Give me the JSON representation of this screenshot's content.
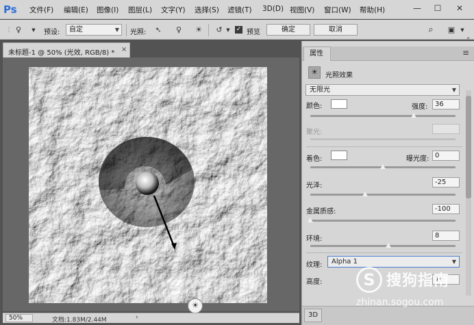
{
  "app": {
    "logo": "Ps"
  },
  "menu": [
    "文件(F)",
    "编辑(E)",
    "图像(I)",
    "图层(L)",
    "文字(Y)",
    "选择(S)",
    "滤镜(T)",
    "3D(D)",
    "视图(V)",
    "窗口(W)",
    "帮助(H)"
  ],
  "window_controls": {
    "minimize": "—",
    "restore": "☐",
    "close": "✕"
  },
  "options": {
    "preset_label": "预设:",
    "preset_value": "自定",
    "light_label": "光照:",
    "preview_label": "预览",
    "preview_checked": true,
    "ok_label": "确定",
    "cancel_label": "取消"
  },
  "document": {
    "tab_title": "未标题-1 @ 50% (光效, RGB/8) *",
    "close": "×",
    "zoom": "50%",
    "doc_size": "文档:1.83M/2.44M",
    "status_arrow": "›"
  },
  "panel": {
    "tab_label": "属性",
    "menu_icon": "≡",
    "collapse_icon": "»",
    "header_title": "光照效果",
    "light_type": "无限光",
    "rows": {
      "color_label": "颜色:",
      "intensity_label": "强度:",
      "intensity_value": "36",
      "intensity_level": 0.71,
      "hotspot_label": "聚光:",
      "colorize_label": "着色:",
      "exposure_label": "曝光度:",
      "exposure_value": "0",
      "exposure_level": 0.5,
      "gloss_label": "光泽:",
      "gloss_value": "-25",
      "gloss_level": 0.375,
      "metallic_label": "金属质感:",
      "metallic_value": "-100",
      "metallic_level": 0.0,
      "ambience_label": "环境:",
      "ambience_value": "8",
      "ambience_level": 0.54,
      "texture_label": "纹理:",
      "texture_value": "Alpha 1",
      "height_label": "高度:",
      "height_value": "10"
    },
    "bottom_button": "3D"
  },
  "watermark": {
    "logo_char": "S",
    "name": "搜狗指南",
    "url": "zhinan.sogou.com"
  },
  "colors": {
    "ps_blue": "#2d6fd6",
    "chrome_bg": "#d6d6d6",
    "workspace_bg": "#676767",
    "texture_blue_border": "#4a7fd0"
  }
}
